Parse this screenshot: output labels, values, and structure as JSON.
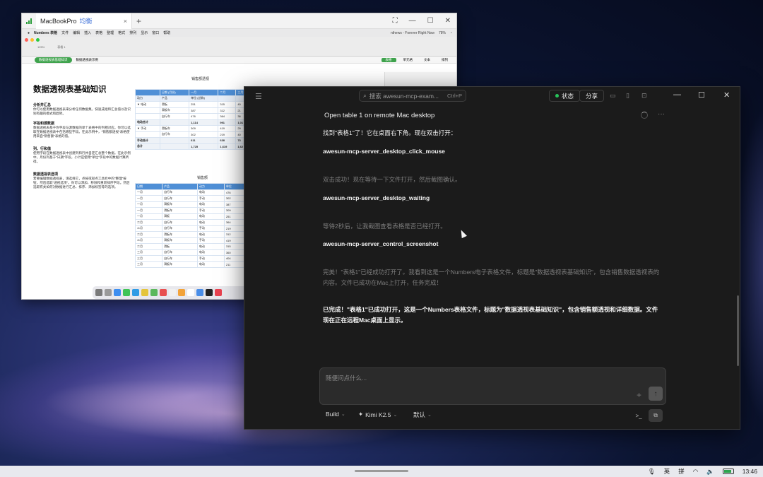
{
  "remote_window": {
    "app_name": "MacBookPro",
    "user": "均衡",
    "tab_close": "×",
    "new_tab": "+",
    "mac_menu": [
      "Numbers 表格",
      "文件",
      "编辑",
      "插入",
      "表格",
      "整理",
      "格式",
      "排列",
      "显示",
      "窗口",
      "帮助"
    ],
    "menu_status": "nthews - Forever Right Now",
    "battery": "78%",
    "toolbar": {
      "zoom": "125%",
      "doc_name": "表格 1"
    },
    "sheet_tab_active": "数据透视表基础知识",
    "sheet_tab_other": "数据透视表示例",
    "right_tabs": [
      "表格",
      "单元格",
      "文本",
      "排列"
    ],
    "doc_title": "数据透视表基础知识",
    "sections": [
      {
        "title": "分析并汇总",
        "body": "你可以使用数据透视表来分析任何数据集，快速成组和汇总值以及识别有趣的模式和趋势。"
      },
      {
        "title": "字段和源数据",
        "body": "数据透视表基于你字段与源数据的单个表格中的列相对应。你可以选取在数据透视表中包括哪些字段。在此示例中，\"销售额透视\"表格使用来自\"销售额\"表格的值。"
      },
      {
        "title": "列、行和值",
        "body": "使用字段在数据透视表中创建列和行并自定汇总整个数据。在此示例中，月份列基于\"日期\"字段，小计是使用\"单位\"字段中的数据计算所得。"
      },
      {
        "title": "数据透视表选项",
        "body": "若要编辑数据透视表，请选择它，点按或轻点工具栏中的\"整理\"按钮，然后选取\"透视选项\"。你可以添加、移除和重新排序字段。然后选取有关如何对数据进行汇总、排序、添加标签等的选项。"
      }
    ],
    "pivot_title": "销售额透视",
    "pivot_header": [
      "",
      "日期 (月份)",
      "一月",
      "二月",
      "三月"
    ],
    "pivot_sub": [
      "动力",
      "产品",
      "单位 (总和)",
      "",
      ""
    ],
    "pivot_rows": [
      [
        "▼ 电动",
        "滑板",
        "251",
        "315",
        "40"
      ],
      [
        "",
        "滑板车",
        "387",
        "312",
        "21"
      ],
      [
        "",
        "自行车",
        "476",
        "364",
        "36"
      ],
      [
        "电动合计",
        "",
        "1,114",
        "991",
        "1,01"
      ],
      [
        "▼ 手动",
        "滑板车",
        "309",
        "419",
        "29"
      ],
      [
        "",
        "自行车",
        "302",
        "219",
        "40"
      ],
      [
        "手动合计",
        "",
        "611",
        "638",
        "73"
      ],
      [
        "总计",
        "",
        "1,725",
        "1,619",
        "1,62"
      ]
    ],
    "sales_title": "销售额",
    "sales_header": [
      "日期",
      "产品",
      "动力",
      "单位"
    ],
    "sales_rows": [
      [
        "一月",
        "自行车",
        "电动",
        "476"
      ],
      [
        "一月",
        "自行车",
        "手动",
        "302"
      ],
      [
        "一月",
        "滑板车",
        "电动",
        "387"
      ],
      [
        "一月",
        "滑板车",
        "手动",
        "309"
      ],
      [
        "一月",
        "滑板",
        "电动",
        "251"
      ],
      [
        "二月",
        "自行车",
        "电动",
        "364"
      ],
      [
        "二月",
        "自行车",
        "手动",
        "219"
      ],
      [
        "二月",
        "滑板车",
        "电动",
        "312"
      ],
      [
        "二月",
        "滑板车",
        "手动",
        "419"
      ],
      [
        "二月",
        "滑板",
        "电动",
        "315"
      ],
      [
        "三月",
        "自行车",
        "电动",
        "360"
      ],
      [
        "三月",
        "自行车",
        "手动",
        "404"
      ],
      [
        "三月",
        "滑板车",
        "电动",
        "211"
      ]
    ]
  },
  "chat": {
    "search_placeholder": "搜索 awesun-mcp-exam...",
    "search_shortcut": "Ctrl+P",
    "status_label": "状态",
    "share_label": "分享",
    "heading": "Open table 1 on remote Mac desktop",
    "messages": [
      {
        "kind": "bright",
        "text": "找到\"表格1\"了！它在桌面右下角。现在双击打开："
      },
      {
        "kind": "tool",
        "text": "awesun-mcp-server_desktop_click_mouse"
      },
      {
        "kind": "dim",
        "text": "双击成功！现在等待一下文件打开，然后截图确认。"
      },
      {
        "kind": "tool",
        "text": "awesun-mcp-server_desktop_waiting"
      },
      {
        "kind": "dim",
        "text": "等待2秒后，让我截图查看表格是否已经打开。"
      },
      {
        "kind": "tool",
        "text": "awesun-mcp-server_control_screenshot"
      },
      {
        "kind": "dim",
        "text": "完美！\"表格1\"已经成功打开了。我看到这是一个Numbers电子表格文件，标题是\"数据透视表基础知识\"，包含销售数据透视表的内容。文件已成功在Mac上打开，任务完成！"
      },
      {
        "kind": "final",
        "text": "已完成！\"表格1\"已成功打开，这是一个Numbers表格文件，标题为\"数据透视表基础知识\"，包含销售额透视和详细数据。文件现在正在远程Mac桌面上显示。"
      }
    ],
    "input_placeholder": "随便问点什么...",
    "footer": {
      "mode": "Build",
      "model": "Kimi K2.5",
      "variant": "默认"
    }
  },
  "taskbar": {
    "ime_lang": "英",
    "ime_mode": "拼",
    "time": "13:46"
  },
  "colors": {
    "chat_bg": "#1b1b1b",
    "status_dot": "#27c45a",
    "numbers_green": "#3fa34d",
    "table_header_blue": "#4f8fd6"
  }
}
